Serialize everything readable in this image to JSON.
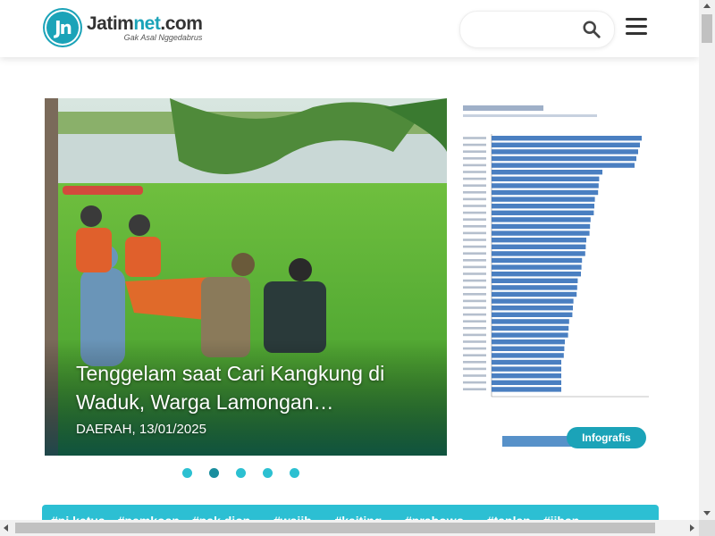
{
  "header": {
    "logo": {
      "mark": "Jn",
      "name_part1": "Jatim",
      "name_part2": "net",
      "name_part3": ".com",
      "tagline": "Gak Asal Nggedabrus"
    },
    "search": {
      "placeholder": "",
      "icon": "search-icon"
    },
    "menu_icon": "hamburger-icon"
  },
  "slider": {
    "title": "Tenggelam saat Cari Kangkung di Waduk, Warga Lamongan…",
    "category": "DAERAH",
    "date": "13/01/2025",
    "meta": "DAERAH, 13/01/2025",
    "dots": 5,
    "active_dot": 1
  },
  "infographic": {
    "badge": "Infografis",
    "bar_color": "#4a7fc1",
    "bar_count": 38
  },
  "tagbar": {
    "color": "#2cbfd3",
    "tags": [
      "#pj ketua",
      "#pemkoan",
      "#pak dion...",
      "#wajib...",
      "#kaiting...",
      "#prabowo...",
      "#tanlan",
      "#jiban"
    ]
  },
  "colors": {
    "brand": "#1ba3b8",
    "dot": "#2cc0d1",
    "dot_active": "#1a8e9e"
  }
}
